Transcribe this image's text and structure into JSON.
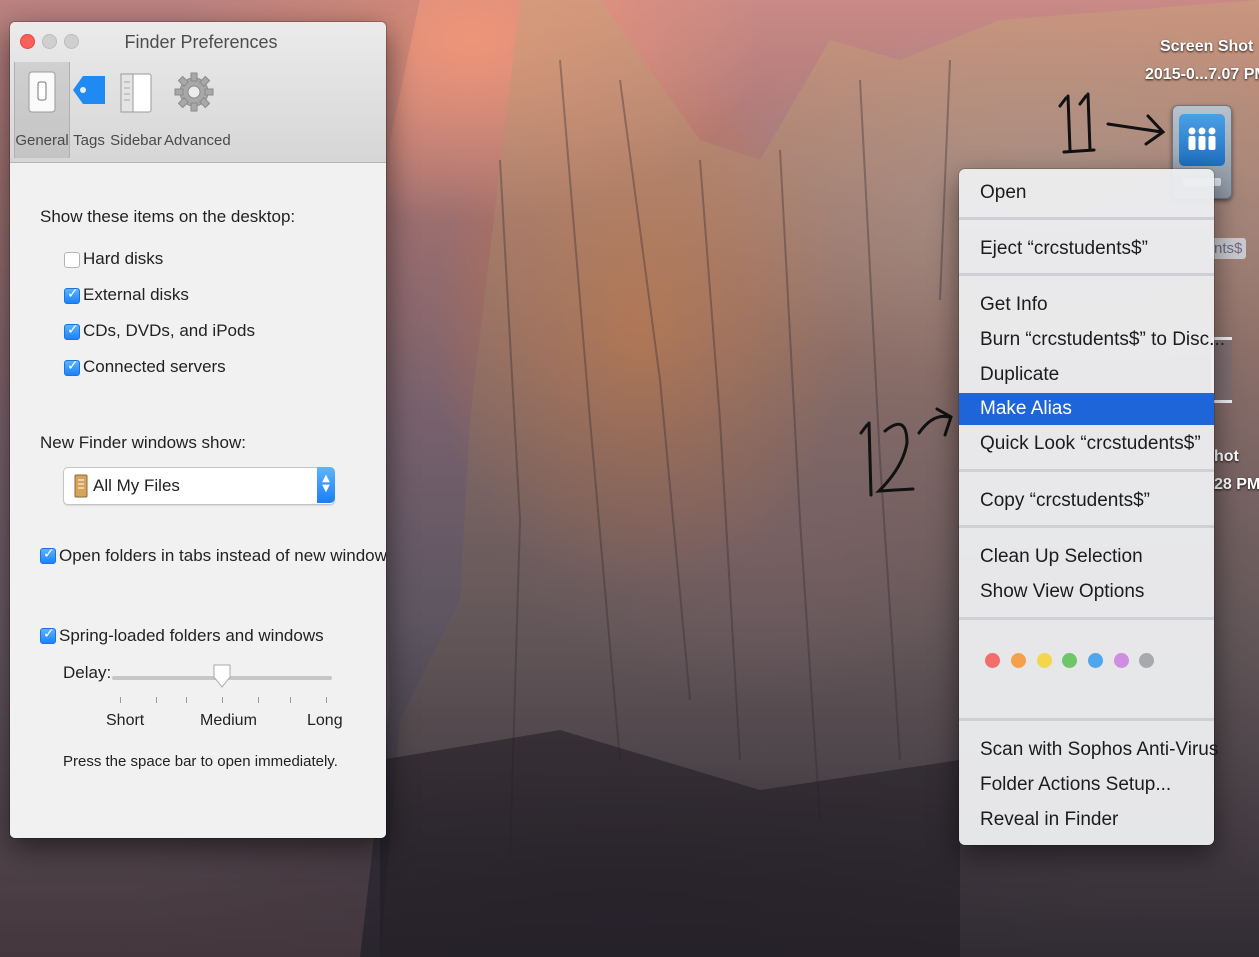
{
  "desktop": {
    "screenshot_label_line1": "Screen Shot",
    "screenshot_label_line2": "2015-0...7.07 PM",
    "server_label_partial": "nts$",
    "second_label_line1": "hot",
    "second_label_line2": "28 PM"
  },
  "annotations": {
    "step_a": "11",
    "step_b": "12"
  },
  "prefs": {
    "title": "Finder Preferences",
    "tabs": [
      {
        "label": "General",
        "icon": "general-switch-icon",
        "selected": true
      },
      {
        "label": "Tags",
        "icon": "tag-icon"
      },
      {
        "label": "Sidebar",
        "icon": "sidebar-icon"
      },
      {
        "label": "Advanced",
        "icon": "gear-icon"
      }
    ],
    "show_items_heading": "Show these items on the desktop:",
    "desktop_items": [
      {
        "label": "Hard disks",
        "checked": false
      },
      {
        "label": "External disks",
        "checked": true
      },
      {
        "label": "CDs, DVDs, and iPods",
        "checked": true
      },
      {
        "label": "Connected servers",
        "checked": true
      }
    ],
    "new_window_heading": "New Finder windows show:",
    "new_window_value": "All My Files",
    "open_in_tabs": {
      "label": "Open folders in tabs instead of new windows",
      "checked": true
    },
    "spring_loaded": {
      "label": "Spring-loaded folders and windows",
      "checked": true
    },
    "delay_label": "Delay:",
    "delay_ticks": [
      "Short",
      "Medium",
      "Long"
    ],
    "delay_value": 0.5,
    "hint": "Press the space bar to open immediately."
  },
  "menu": {
    "items": [
      "Open",
      "Eject “crcstudents$”",
      "Get Info",
      "Burn “crcstudents$” to Disc...",
      "Duplicate",
      "Make Alias",
      "Quick Look “crcstudents$”",
      "Copy “crcstudents$”",
      "Clean Up Selection",
      "Show View Options",
      "Scan with Sophos Anti-Virus",
      "Folder Actions Setup...",
      "Reveal in Finder"
    ],
    "highlighted": "Make Alias",
    "tag_colors": [
      "#f26d6d",
      "#f5a14b",
      "#f2d64b",
      "#6cc66a",
      "#4ea7ee",
      "#cf8ee0",
      "#a9a9ad"
    ]
  }
}
